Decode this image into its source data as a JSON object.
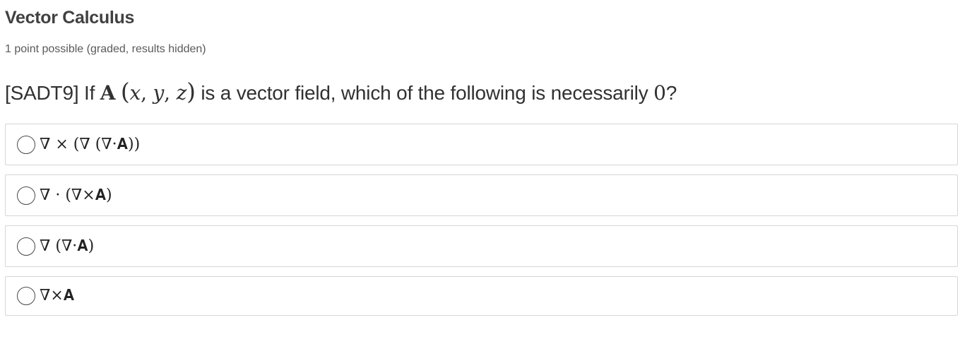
{
  "problem": {
    "title": "Vector Calculus",
    "points": "1 point possible (graded, results hidden)"
  },
  "question": {
    "prefix": "[SADT9] If ",
    "field_symbol": "A",
    "open_paren": "(",
    "var_x": "x",
    "comma1": ", ",
    "var_y": "y",
    "comma2": ", ",
    "var_z": "z",
    "close_paren": ")",
    "middle": " is a vector field, which of the following is necessarily ",
    "zero": "0",
    "suffix": "?"
  },
  "choices": [
    {
      "label": "∇ × (∇ (∇·𝐀))",
      "selected": false
    },
    {
      "label": "∇ · (∇×𝐀)",
      "selected": false
    },
    {
      "label": "∇ (∇·𝐀)",
      "selected": false
    },
    {
      "label": "∇×𝐀",
      "selected": false
    }
  ]
}
